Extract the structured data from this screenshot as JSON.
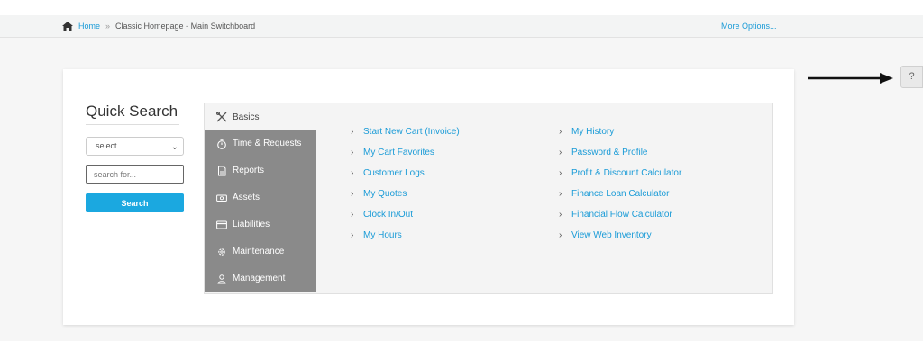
{
  "breadcrumb": {
    "home": "Home",
    "separator": "»",
    "current": "Classic Homepage - Main Switchboard",
    "more_options": "More Options..."
  },
  "quick_search": {
    "title": "Quick Search",
    "select_value": "select...",
    "input_placeholder": "search for...",
    "button_label": "Search"
  },
  "tabs": [
    {
      "label": "Basics",
      "icon": "tools-icon",
      "active": true
    },
    {
      "label": "Time & Requests",
      "icon": "stopwatch-icon"
    },
    {
      "label": "Reports",
      "icon": "report-icon"
    },
    {
      "label": "Assets",
      "icon": "money-icon"
    },
    {
      "label": "Liabilities",
      "icon": "credit-card-icon"
    },
    {
      "label": "Maintenance",
      "icon": "gear-icon"
    },
    {
      "label": "Management",
      "icon": "user-icon"
    }
  ],
  "links": {
    "col1": [
      "Start New Cart (Invoice)",
      "My Cart Favorites",
      "Customer Logs",
      "My Quotes",
      "Clock In/Out",
      "My Hours"
    ],
    "col2": [
      "My History",
      "Password & Profile",
      "Profit & Discount Calculator",
      "Finance Loan Calculator",
      "Financial Flow Calculator",
      "View Web Inventory"
    ]
  },
  "help": {
    "label": "?"
  },
  "colors": {
    "accent": "#1ba8e0",
    "link": "#1a9bd7",
    "tab_bg": "#8a8a8a"
  }
}
